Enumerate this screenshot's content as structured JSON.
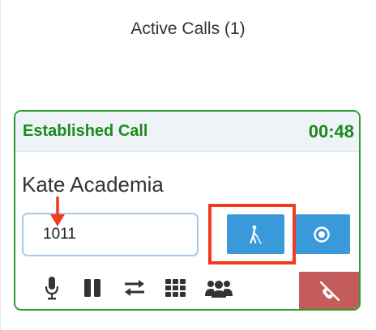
{
  "page": {
    "title": "Active Calls (1)"
  },
  "call": {
    "status": "Established Call",
    "timer": "00:48",
    "caller_name": "Kate Academia",
    "number_value": "1011"
  },
  "colors": {
    "established_green": "#1c8a1c",
    "card_border": "#2e9a2e",
    "action_blue": "#3a9ad9",
    "hangup_red": "#c45c5c",
    "annotation_red": "#f23a1f"
  },
  "icons": {
    "transfer": "blind-transfer-icon",
    "record": "record-icon",
    "mute": "microphone-icon",
    "hold": "pause-icon",
    "swap": "exchange-icon",
    "keypad": "dialpad-icon",
    "conference": "users-icon",
    "hangup": "phone-hangup-icon"
  }
}
